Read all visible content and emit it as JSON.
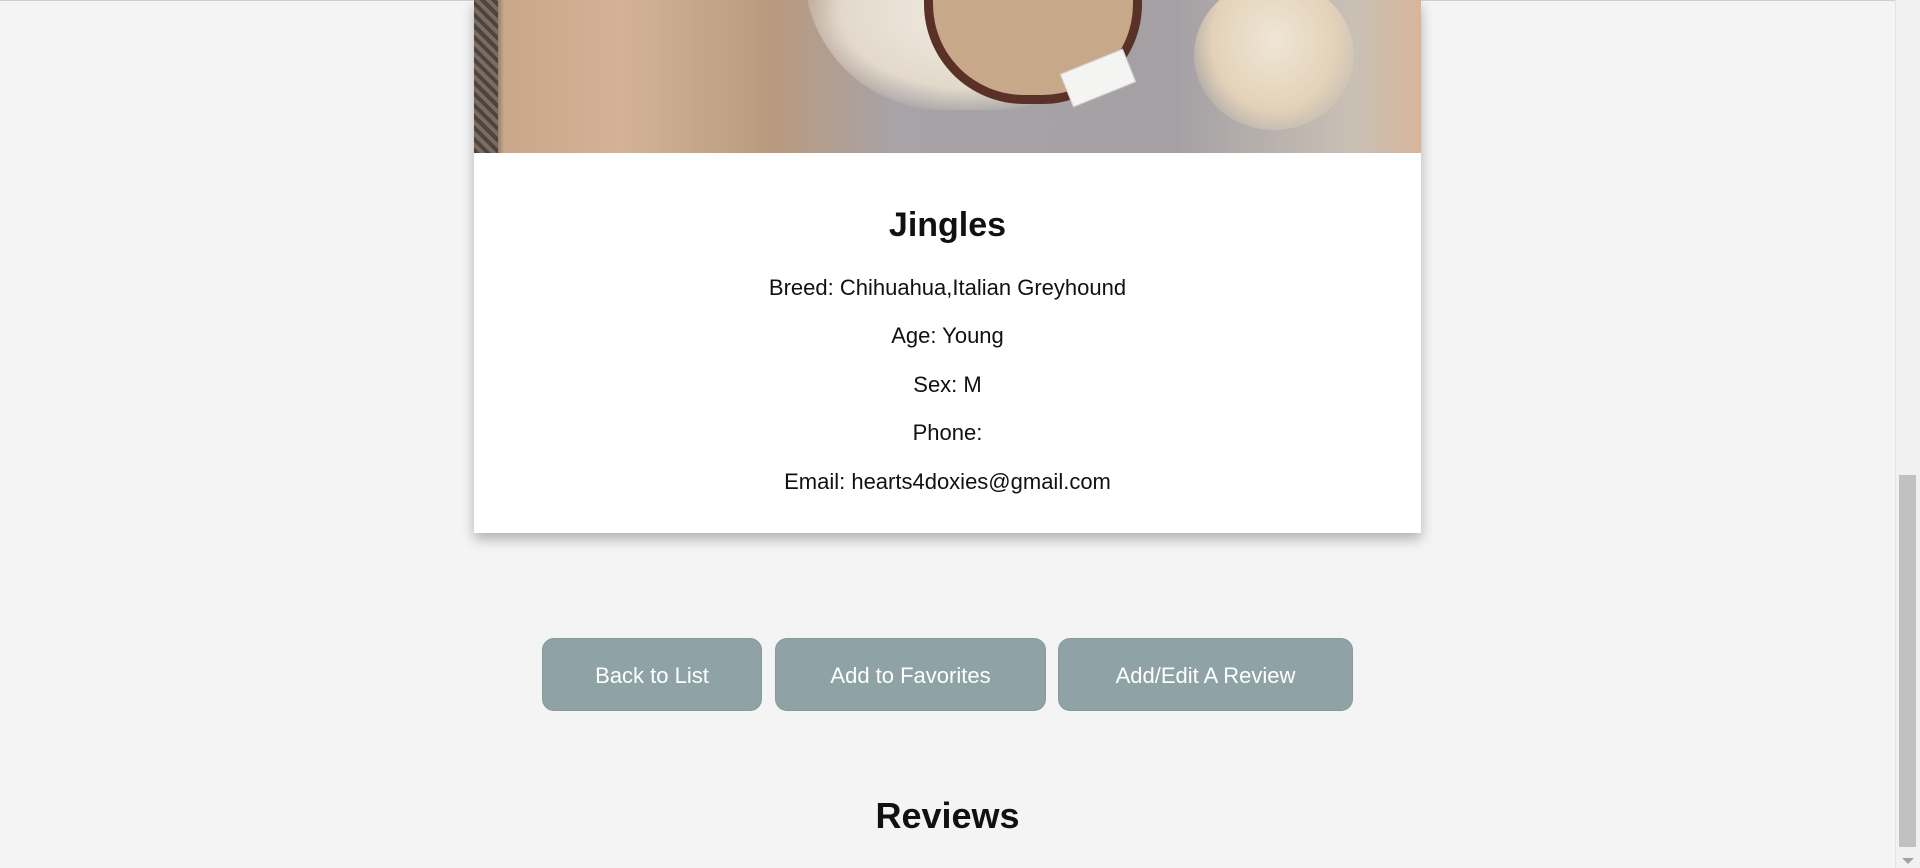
{
  "pet": {
    "name": "Jingles",
    "breed": "Breed: Chihuahua,Italian Greyhound",
    "age": "Age: Young",
    "sex": "Sex: M",
    "phone": "Phone:",
    "email": "Email: hearts4doxies@gmail.com"
  },
  "actions": {
    "back_label": "Back to List",
    "favorites_label": "Add to Favorites",
    "review_label": "Add/Edit A Review"
  },
  "reviews": {
    "title": "Reviews"
  },
  "colors": {
    "page_bg": "#f4f4f4",
    "button_bg": "#8fa3a7",
    "button_text": "#ffffff"
  },
  "scroll": {
    "position": 0.88
  }
}
